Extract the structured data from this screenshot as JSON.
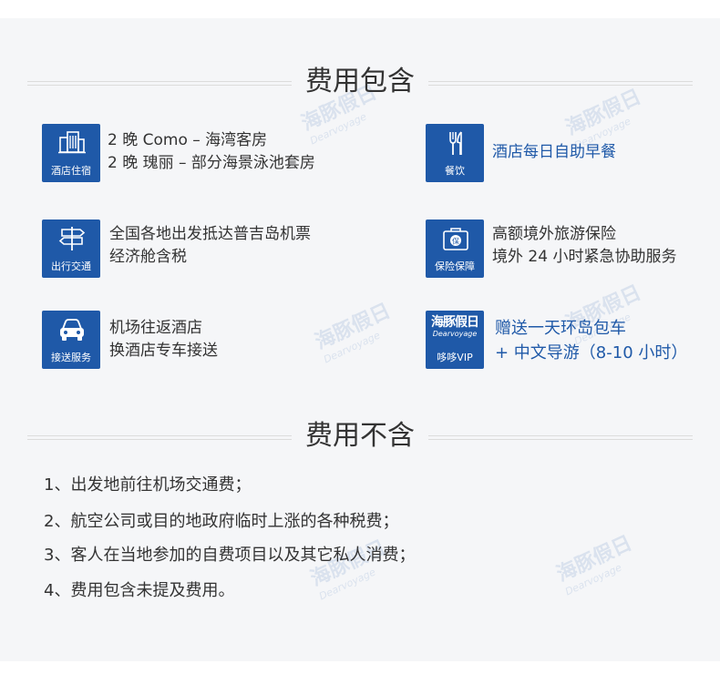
{
  "included": {
    "title": "费用包含",
    "items": [
      {
        "icon": "hotel-icon",
        "caption": "酒店住宿",
        "lines": [
          "2 晚 Como – 海湾客房",
          "2 晚 瑰丽 – 部分海景泳池套房"
        ]
      },
      {
        "icon": "cutlery-icon",
        "caption": "餐饮",
        "lines": [
          "酒店每日自助早餐"
        ]
      },
      {
        "icon": "signpost-icon",
        "caption": "出行交通",
        "lines": [
          "全国各地出发抵达普吉岛机票",
          "经济舱含税"
        ]
      },
      {
        "icon": "insurance-icon",
        "caption": "保险保障",
        "lines": [
          "高额境外旅游保险",
          "境外 24 小时紧急协助服务"
        ]
      },
      {
        "icon": "car-icon",
        "caption": "接送服务",
        "lines": [
          "机场往返酒店",
          "换酒店专车接送"
        ]
      },
      {
        "icon": "vip-logo-icon",
        "caption": "哆哆VIP",
        "logo_text": "海豚假日",
        "logo_sub": "Dearvoyage",
        "lines": [
          "赠送一天环岛包车",
          "+ 中文导游（8-10 小时）"
        ]
      }
    ]
  },
  "excluded": {
    "title": "费用不含",
    "items": [
      "1、出发地前往机场交通费；",
      "2、航空公司或目的地政府临时上涨的各种税费；",
      "3、客人在当地参加的自费项目以及其它私人消费；",
      "4、费用包含未提及费用。"
    ]
  },
  "watermark": {
    "text": "海豚假日",
    "sub": "Dearvoyage"
  },
  "colors": {
    "accent": "#1f59a8",
    "panel": "#f5f6f8",
    "text": "#333333"
  }
}
